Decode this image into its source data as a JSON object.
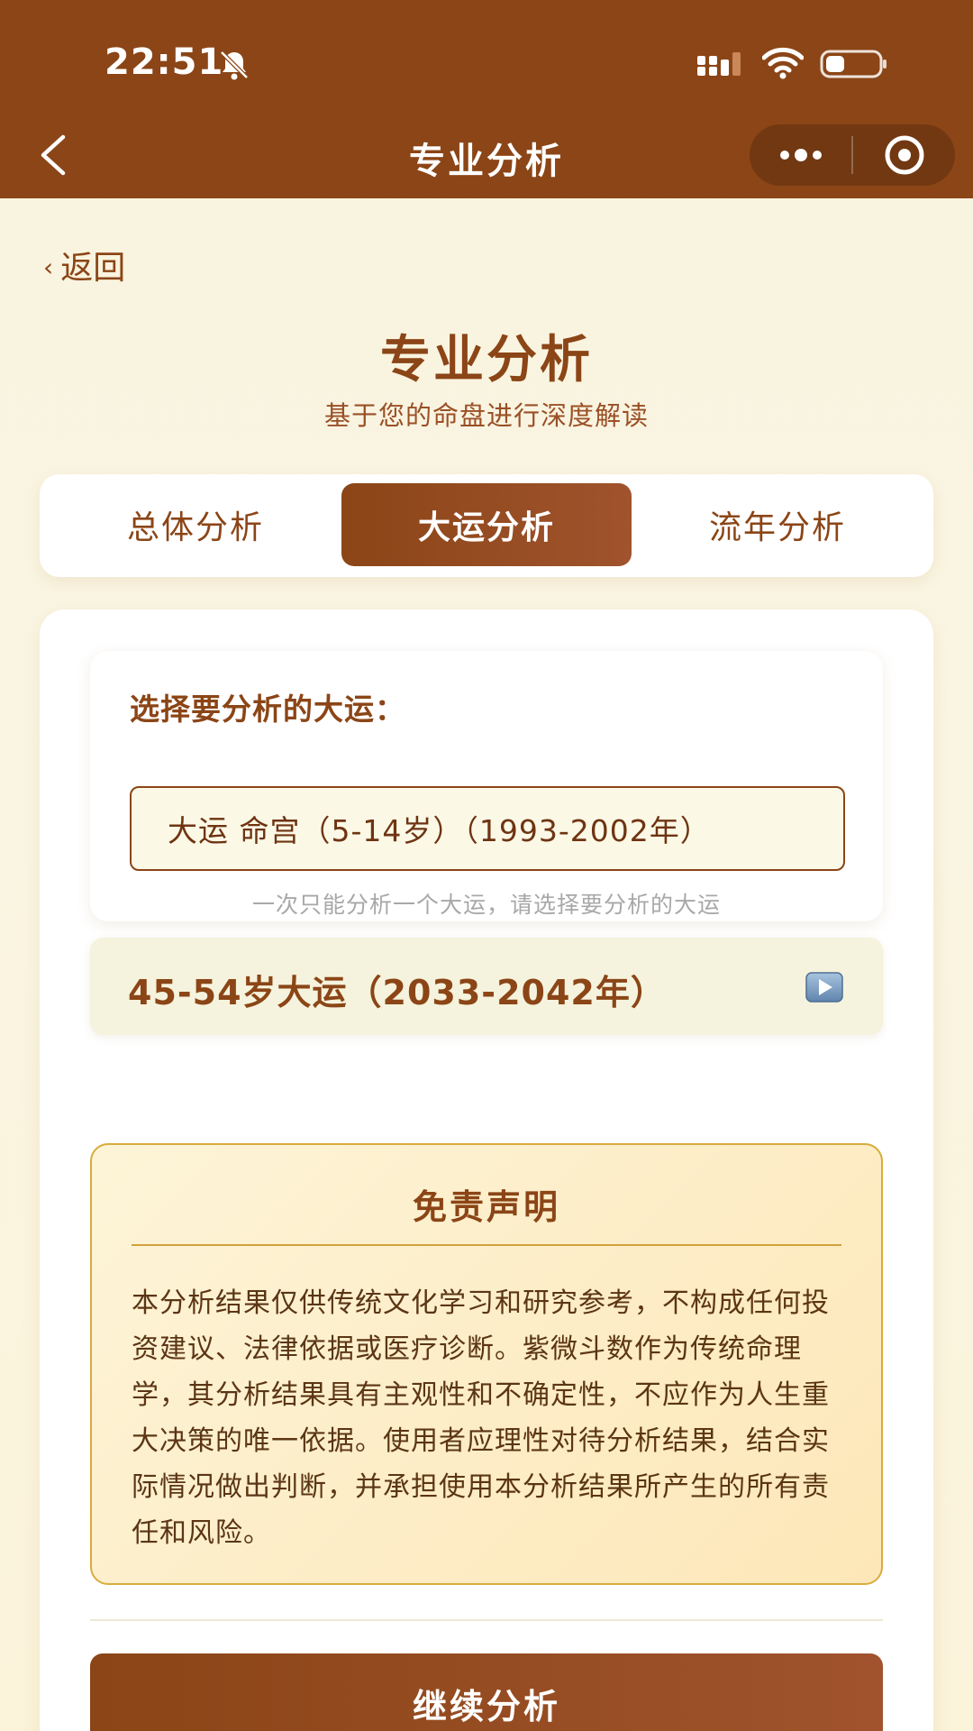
{
  "status_bar": {
    "time": "22:51",
    "icons": [
      "bell-muted-icon",
      "signal-icon",
      "wifi-icon",
      "battery-icon"
    ]
  },
  "nav": {
    "title": "专业分析",
    "back_icon": "chevron-left-icon",
    "capsule_icons": [
      "more-icon",
      "record-icon"
    ]
  },
  "back_link": {
    "chevron": "‹",
    "label": "返回"
  },
  "page": {
    "title": "专业分析",
    "subtitle": "基于您的命盘进行深度解读"
  },
  "tabs": [
    {
      "label": "总体分析",
      "active": false
    },
    {
      "label": "大运分析",
      "active": true
    },
    {
      "label": "流年分析",
      "active": false
    }
  ],
  "selector": {
    "label": "选择要分析的大运：",
    "value": "大运 命宫（5-14岁）（1993-2002年）",
    "hint": "一次只能分析一个大运，请选择要分析的大运"
  },
  "dayun_item": {
    "label": "45-54岁大运（2033-2042年）",
    "icon": "play-icon"
  },
  "disclaimer": {
    "title": "免责声明",
    "body": "本分析结果仅供传统文化学习和研究参考，不构成任何投资建议、法律依据或医疗诊断。紫微斗数作为传统命理学，其分析结果具有主观性和不确定性，不应作为人生重大决策的唯一依据。使用者应理性对待分析结果，结合实际情况做出判断，并承担使用本分析结果所产生的所有责任和风险。"
  },
  "continue_button": {
    "label": "继续分析"
  },
  "colors": {
    "brand_brown": "#8b4516",
    "page_background": "#f8f3dd",
    "disclaimer_border": "#d8ac3c"
  }
}
